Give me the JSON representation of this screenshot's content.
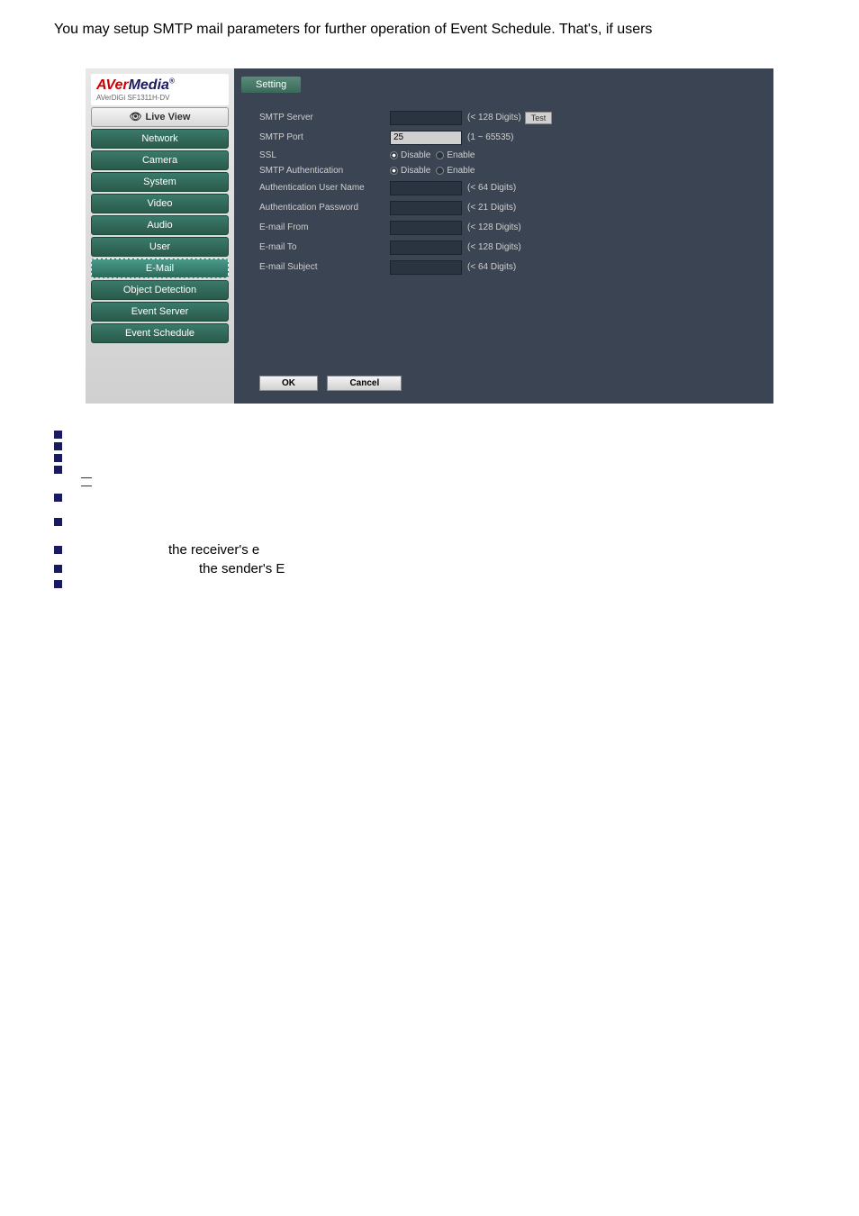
{
  "intro": "You may setup SMTP mail parameters for further operation of Event Schedule. That's, if users",
  "logo": {
    "brand_prefix": "AVer",
    "brand_suffix": "edia",
    "model": "AVerDiGi SF1311H-DV"
  },
  "sidebar": {
    "live_view": "Live View",
    "items": [
      {
        "label": "Network"
      },
      {
        "label": "Camera"
      },
      {
        "label": "System"
      },
      {
        "label": "Video"
      },
      {
        "label": "Audio"
      },
      {
        "label": "User"
      },
      {
        "label": "E-Mail"
      },
      {
        "label": "Object Detection"
      },
      {
        "label": "Event Server"
      },
      {
        "label": "Event Schedule"
      }
    ]
  },
  "main": {
    "tab": "Setting",
    "rows": {
      "smtp_server": {
        "label": "SMTP Server",
        "value": "",
        "hint": "(< 128 Digits)",
        "test_label": "Test"
      },
      "smtp_port": {
        "label": "SMTP Port",
        "value": "25",
        "hint": "(1 ~ 65535)"
      },
      "ssl": {
        "label": "SSL",
        "disable": "Disable",
        "enable": "Enable"
      },
      "smtp_auth": {
        "label": "SMTP Authentication",
        "disable": "Disable",
        "enable": "Enable"
      },
      "auth_user": {
        "label": "Authentication User Name",
        "value": "",
        "hint": "(< 64 Digits)"
      },
      "auth_pass": {
        "label": "Authentication Password",
        "value": "",
        "hint": "(< 21 Digits)"
      },
      "email_from": {
        "label": "E-mail From",
        "value": "",
        "hint": "(< 128 Digits)"
      },
      "email_to": {
        "label": "E-mail To",
        "value": "",
        "hint": "(< 128 Digits)"
      },
      "email_subject": {
        "label": "E-mail Subject",
        "value": "",
        "hint": "(< 64 Digits)"
      }
    },
    "buttons": {
      "ok": "OK",
      "cancel": "Cancel"
    }
  },
  "bullets": {
    "receiver": "the receiver's e",
    "sender": "the sender's E"
  }
}
